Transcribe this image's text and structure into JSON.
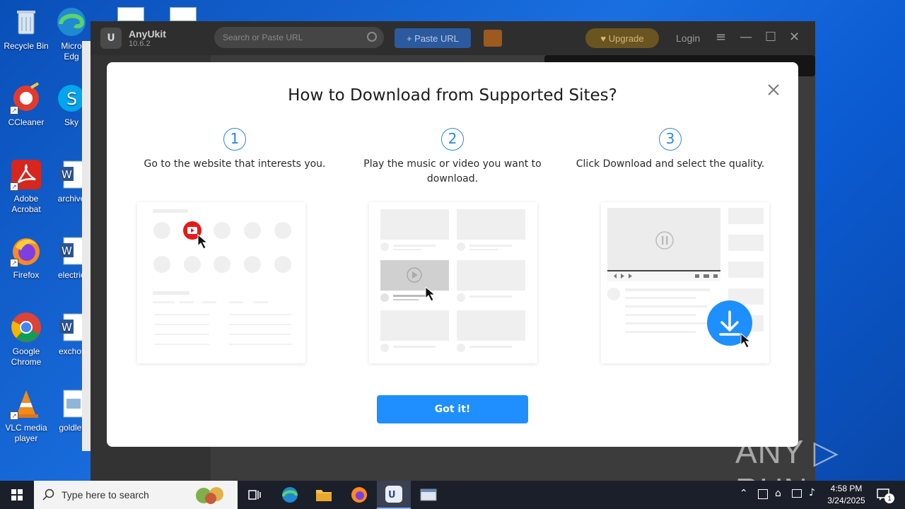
{
  "desktop": {
    "icons": [
      {
        "label": "Recycle Bin"
      },
      {
        "label": "CCleaner"
      },
      {
        "label": "Adobe Acrobat"
      },
      {
        "label": "Firefox"
      },
      {
        "label": "Google Chrome"
      },
      {
        "label": "VLC media player"
      },
      {
        "label": "Micro Edg"
      },
      {
        "label": "Sky"
      },
      {
        "label": "archive"
      },
      {
        "label": "electric"
      },
      {
        "label": "exchor"
      },
      {
        "label": "goldlet"
      }
    ]
  },
  "app": {
    "logo": "U",
    "name": "AnyUkit",
    "version": "10.6.2",
    "search_placeholder": "Search or Paste URL",
    "paste_url_label": "+ Paste URL",
    "upgrade_label": "♥ Upgrade",
    "login_label": "Login"
  },
  "modal": {
    "title": "How to Download from Supported Sites?",
    "steps": [
      {
        "number": "1",
        "text": "Go to the website that interests you."
      },
      {
        "number": "2",
        "text": "Play the music or video you want to download."
      },
      {
        "number": "3",
        "text": "Click Download and select the quality."
      }
    ],
    "button_label": "Got it!"
  },
  "watermark": "ANY ▷ RUN",
  "taskbar": {
    "search_placeholder": "Type here to search",
    "time": "4:58 PM",
    "date": "3/24/2025",
    "notification_count": "1"
  }
}
